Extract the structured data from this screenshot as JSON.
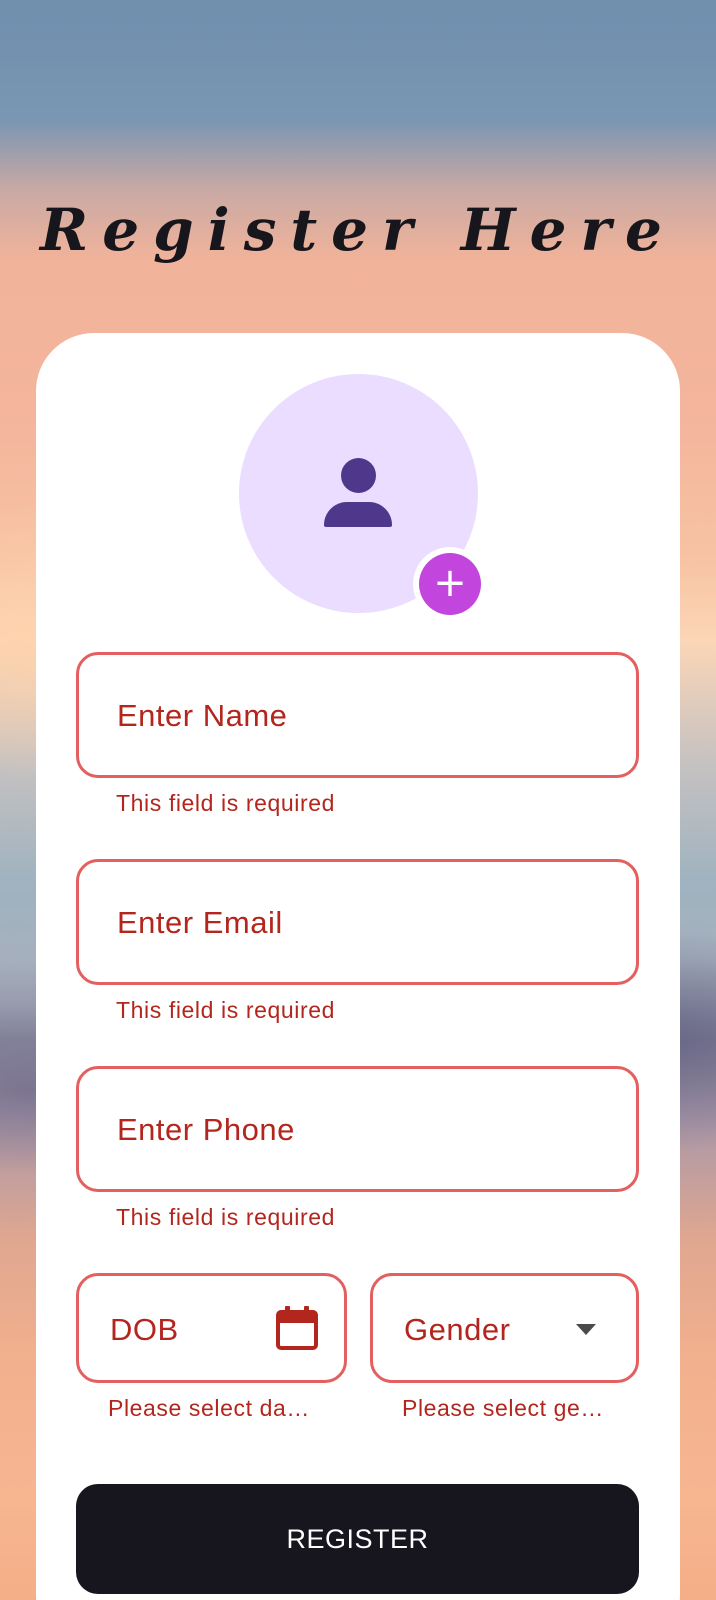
{
  "header": {
    "title": "Register Here"
  },
  "avatar": {
    "icon": "person-icon",
    "add_icon": "plus-icon",
    "add_symbol": "+"
  },
  "form": {
    "name": {
      "label": "Enter Name",
      "error": "This field is required"
    },
    "email": {
      "label": "Enter Email",
      "error": "This field is required"
    },
    "phone": {
      "label": "Enter Phone",
      "error": "This field is required"
    },
    "dob": {
      "label": "DOB",
      "error": "Please select da…",
      "icon": "calendar-icon"
    },
    "gender": {
      "label": "Gender",
      "error": "Please select ge…",
      "icon": "dropdown-arrow-icon"
    }
  },
  "actions": {
    "register_label": "REGISTER"
  },
  "colors": {
    "error": "#b3261e",
    "error_border": "#e46060",
    "avatar_bg": "#eaddff",
    "avatar_icon": "#4f378b",
    "add_button": "#c246de",
    "register_button": "#17161f"
  }
}
